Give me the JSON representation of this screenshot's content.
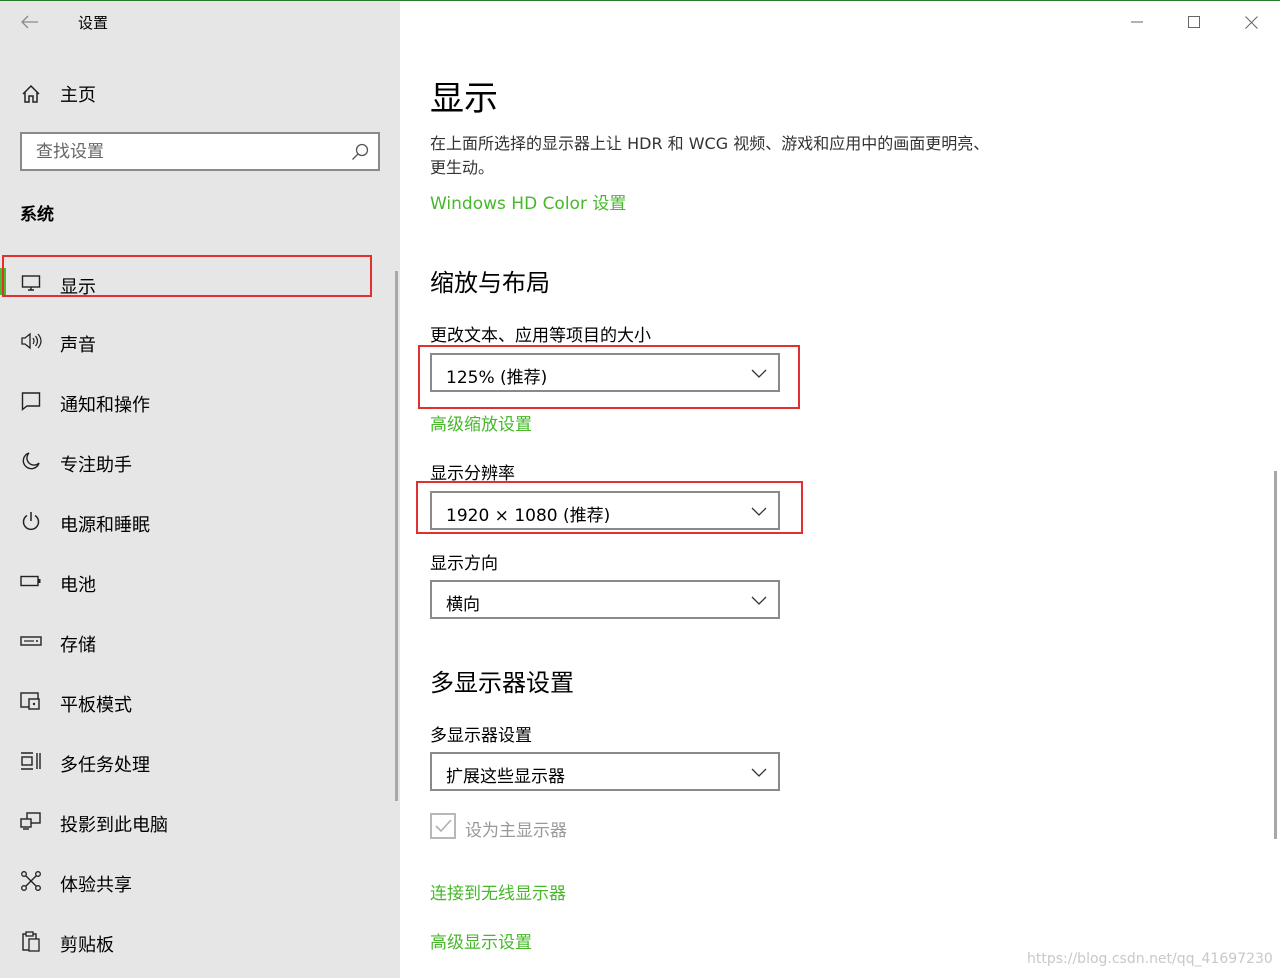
{
  "window": {
    "title": "设置"
  },
  "sidebar": {
    "home_label": "主页",
    "search_placeholder": "查找设置",
    "section_title": "系统",
    "items": [
      {
        "label": "显示",
        "icon": "monitor-icon",
        "selected": true
      },
      {
        "label": "声音",
        "icon": "speaker-icon"
      },
      {
        "label": "通知和操作",
        "icon": "notification-icon"
      },
      {
        "label": "专注助手",
        "icon": "moon-icon"
      },
      {
        "label": "电源和睡眠",
        "icon": "power-icon"
      },
      {
        "label": "电池",
        "icon": "battery-icon"
      },
      {
        "label": "存储",
        "icon": "storage-icon"
      },
      {
        "label": "平板模式",
        "icon": "tablet-mode-icon"
      },
      {
        "label": "多任务处理",
        "icon": "multitasking-icon"
      },
      {
        "label": "投影到此电脑",
        "icon": "project-icon"
      },
      {
        "label": "体验共享",
        "icon": "share-icon"
      },
      {
        "label": "剪贴板",
        "icon": "clipboard-icon"
      }
    ]
  },
  "main": {
    "title": "显示",
    "description": "在上面所选择的显示器上让 HDR 和 WCG 视频、游戏和应用中的画面更明亮、更生动。",
    "hd_color_link": "Windows HD Color 设置",
    "scale_section": {
      "title": "缩放与布局",
      "text_size_label": "更改文本、应用等项目的大小",
      "text_size_value": "125% (推荐)",
      "advanced_scaling_link": "高级缩放设置",
      "resolution_label": "显示分辨率",
      "resolution_value": "1920 × 1080 (推荐)",
      "orientation_label": "显示方向",
      "orientation_value": "横向"
    },
    "multi_display": {
      "title": "多显示器设置",
      "label": "多显示器设置",
      "value": "扩展这些显示器",
      "make_main_label": "设为主显示器",
      "make_main_checked": true,
      "make_main_disabled": true,
      "connect_wireless_link": "连接到无线显示器",
      "advanced_display_link": "高级显示设置"
    }
  },
  "watermark": "https://blog.csdn.net/qq_41697230",
  "colors": {
    "accent": "#46b82a",
    "annotation": "#e03030",
    "sidebar_bg": "#e6e6e6"
  }
}
